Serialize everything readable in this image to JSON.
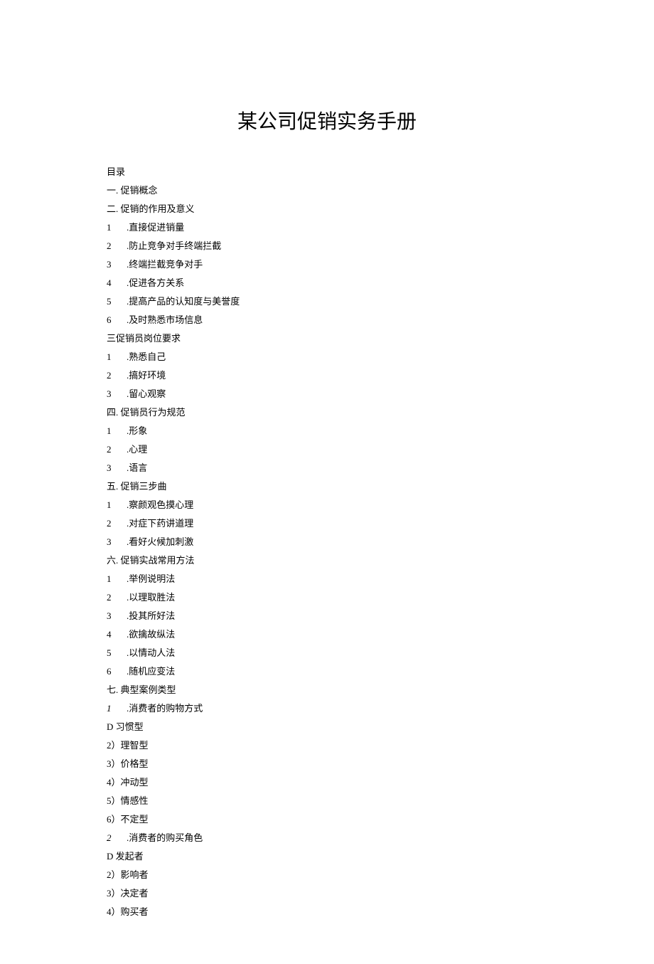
{
  "title": "某公司促销实务手册",
  "lines": [
    {
      "t": "目录"
    },
    {
      "t": "一. 促销概念"
    },
    {
      "t": "二. 促销的作用及意义"
    },
    {
      "n": "1",
      "t": ".直接促进销量"
    },
    {
      "n": "2",
      "t": ".防止竞争对手终端拦截"
    },
    {
      "n": "3",
      "t": ".终端拦截竞争对手"
    },
    {
      "n": "4",
      "t": ".促进各方关系"
    },
    {
      "n": "5",
      "t": ".提高产品的认知度与美誉度"
    },
    {
      "n": "6",
      "t": ".及时熟悉市场信息"
    },
    {
      "t": "三促销员岗位要求"
    },
    {
      "n": "1",
      "t": ".熟悉自己"
    },
    {
      "n": "2",
      "t": ".搞好环境"
    },
    {
      "n": "3",
      "t": ".留心观察"
    },
    {
      "t": "四. 促销员行为规范"
    },
    {
      "n": "1",
      "t": ".形象"
    },
    {
      "n": "2",
      "t": ".心理"
    },
    {
      "n": "3",
      "t": ".语言"
    },
    {
      "t": "五. 促销三步曲"
    },
    {
      "n": "1",
      "t": ".察颜观色摸心理"
    },
    {
      "n": "2",
      "t": ".对症下药讲道理"
    },
    {
      "n": "3",
      "t": ".看好火候加刺激"
    },
    {
      "t": "六. 促销实战常用方法"
    },
    {
      "n": "1",
      "t": ".举例说明法"
    },
    {
      "n": "2",
      "t": ".以理取胜法"
    },
    {
      "n": "3",
      "t": ".投其所好法"
    },
    {
      "n": "4",
      "t": ".欲擒故纵法"
    },
    {
      "n": "5",
      "t": ".以情动人法"
    },
    {
      "n": "6",
      "t": ".随机应变法"
    },
    {
      "t": "七. 典型案例类型"
    },
    {
      "n": "1",
      "t": ".消费者的购物方式",
      "italic": true
    },
    {
      "t": "D 习惯型"
    },
    {
      "t": "2）理智型"
    },
    {
      "t": "3）价格型"
    },
    {
      "t": "4）冲动型"
    },
    {
      "t": "5）情感性"
    },
    {
      "t": "6）不定型"
    },
    {
      "n": "2",
      "t": ".消费者的购买角色",
      "italic": true
    },
    {
      "t": "D 发起者"
    },
    {
      "t": "2）影响者"
    },
    {
      "t": "3）决定者"
    },
    {
      "t": "4）购买者"
    }
  ]
}
